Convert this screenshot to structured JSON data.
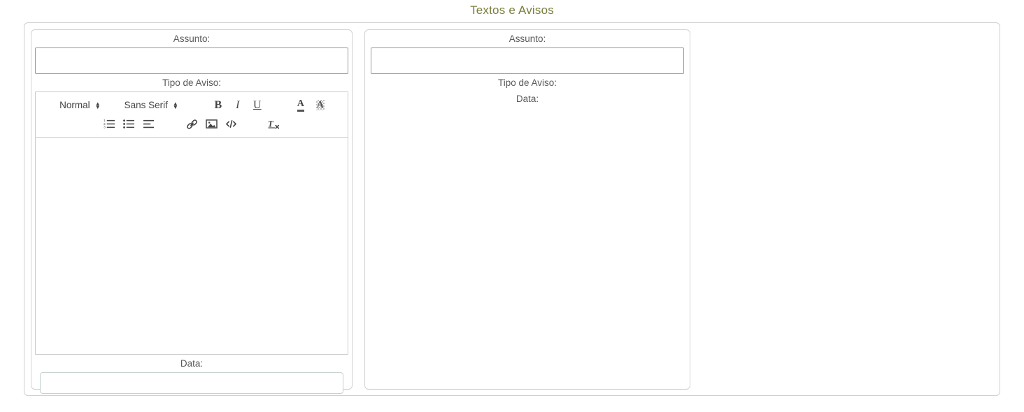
{
  "page": {
    "title": "Textos e Avisos",
    "title_color": "#7a7d3c"
  },
  "panels": [
    {
      "id": "left",
      "fields": {
        "subject_label": "Assunto:",
        "subject_value": "",
        "subject_placeholder": "",
        "notice_type_label": "Tipo de Aviso:",
        "date_label": "Data:",
        "date_value": "",
        "date_placeholder": "",
        "body_value": ""
      },
      "editor": {
        "toolbar": {
          "row1": {
            "heading_select": "Normal",
            "font_select": "Sans Serif",
            "bold": "B",
            "italic": "I",
            "underline": "U",
            "text_color": "A",
            "background_color": "A"
          },
          "row2": {
            "ordered_list": "ordered-list-icon",
            "bullet_list": "bullet-list-icon",
            "align": "align-icon",
            "link": "link-icon",
            "image": "image-icon",
            "code": "code-icon",
            "clear_format": "clear-format-icon"
          }
        }
      }
    },
    {
      "id": "right",
      "fields": {
        "subject_label": "Assunto:",
        "subject_value": "",
        "subject_placeholder": "",
        "notice_type_label": "Tipo de Aviso:",
        "date_label": "Data:"
      }
    }
  ]
}
